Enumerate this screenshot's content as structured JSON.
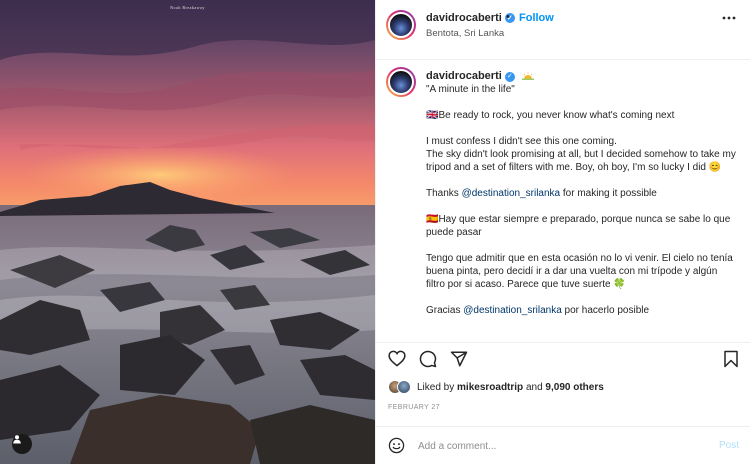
{
  "photo": {
    "watermark": "Noah Breakaway",
    "tag_icon": "person-icon"
  },
  "header": {
    "username": "davidrocaberti",
    "separator": "•",
    "follow_label": "Follow",
    "location": "Bentota, Sri Lanka"
  },
  "caption": {
    "username": "davidrocaberti",
    "title": "\"A minute in the life\"",
    "lines": [
      "🇬🇧Be ready to rock, you never know what's coming next",
      "I must confess I didn't see this one coming.\nThe sky didn't look promising at all, but I decided somehow to take my tripod and a set of filters with me. Boy, oh boy, I'm so lucky I did 😊"
    ],
    "thanks_prefix": "Thanks ",
    "thanks_mention": "@destination_srilanka",
    "thanks_suffix": " for making it possible",
    "es_line1": "🇪🇸Hay que estar siempre e preparado, porque nunca se sabe lo que puede pasar",
    "es_line2": "Tengo que admitir que en esta ocasión no lo vi venir. El cielo no tenía buena pinta, pero decidí ir a dar una vuelta con mi trípode y algún filtro por si acaso. Parece que tuve suerte 🍀",
    "es_thanks_prefix": "Gracias ",
    "es_thanks_mention": "@destination_srilanka",
    "es_thanks_suffix": " por hacerlo posible"
  },
  "actions": {
    "like_icon": "heart-icon",
    "comment_icon": "comment-icon",
    "share_icon": "share-icon",
    "save_icon": "bookmark-icon"
  },
  "likes": {
    "prefix": "Liked by ",
    "user": "mikesroadtrip",
    "middle": " and ",
    "count": "9,090 others"
  },
  "date": "FEBRUARY 27",
  "comment": {
    "placeholder": "Add a comment...",
    "post_label": "Post"
  },
  "colors": {
    "accent": "#0095f6",
    "verified": "#3897f0",
    "post_disabled": "#b2dffc"
  }
}
